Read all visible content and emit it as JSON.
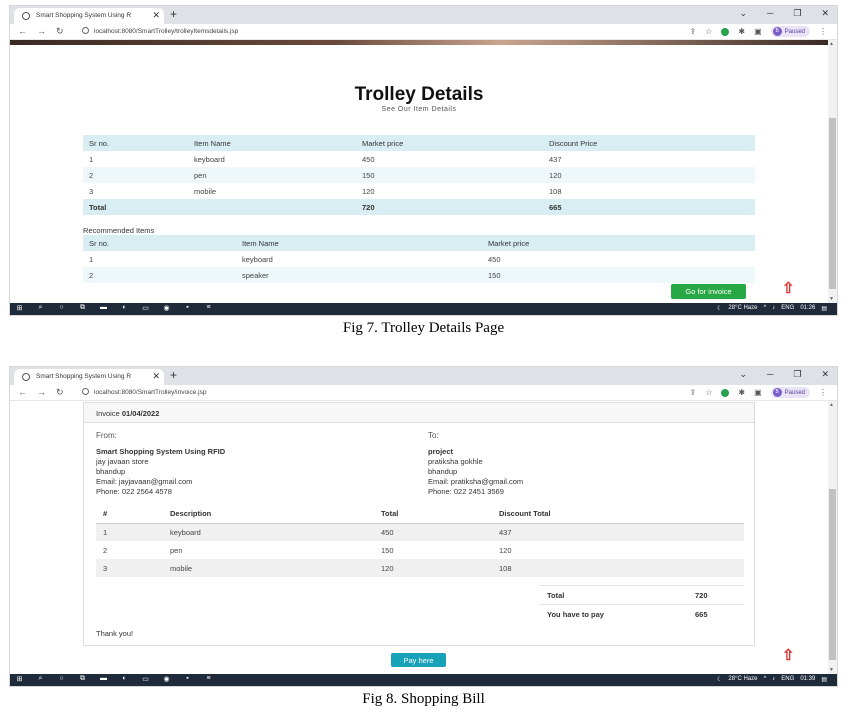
{
  "browser": {
    "tab_title_1": "Smart Shopping System Using R",
    "tab_title_2": "Smart Shopping System Using R",
    "url_1": "localhost:8080/SmartTrolley/trolleyItemsdetails.jsp",
    "url_2": "localhost:8080/SmartTrolley/invoice.jsp",
    "profile_status": "Paused",
    "profile_initial": "B"
  },
  "taskbar": {
    "weather": "28°C Haze",
    "lang": "ENG",
    "time_1": "01:26",
    "time_2": "01:39"
  },
  "trolley": {
    "title": "Trolley Details",
    "subtitle": "See Our Item Details",
    "headers": [
      "Sr no.",
      "Item Name",
      "Market price",
      "Discount Price"
    ],
    "rows": [
      [
        "1",
        "keyboard",
        "450",
        "437"
      ],
      [
        "2",
        "pen",
        "150",
        "120"
      ],
      [
        "3",
        "mobile",
        "120",
        "108"
      ]
    ],
    "total_label": "Total",
    "total_market": "720",
    "total_discount": "665",
    "recommended_label": "Recommended Items",
    "rec_headers": [
      "Sr no.",
      "Item Name",
      "Market price"
    ],
    "rec_rows": [
      [
        "1",
        "keyboard",
        "450"
      ],
      [
        "2",
        "speaker",
        "150"
      ]
    ],
    "invoice_button": "Go for invoice"
  },
  "invoice": {
    "label": "Invoice",
    "date": "01/04/2022",
    "from_label": "From:",
    "from_name": "Smart Shopping System Using RFID",
    "from_lines": [
      "jay javaan store",
      "bhandup",
      "Email: jayjavaan@gmail.com",
      "Phone: 022 2564 4578"
    ],
    "to_label": "To:",
    "to_name": "project",
    "to_lines": [
      "pratiksha gokhle",
      "bhandup",
      "Email: pratiksha@gmail.com",
      "Phone: 022 2451 3569"
    ],
    "headers": [
      "#",
      "Description",
      "Total",
      "Discount Total"
    ],
    "rows": [
      [
        "1",
        "keyboard",
        "450",
        "437"
      ],
      [
        "2",
        "pen",
        "150",
        "120"
      ],
      [
        "3",
        "mobile",
        "120",
        "108"
      ]
    ],
    "total_label": "Total",
    "total_value": "720",
    "pay_label": "You have to pay",
    "pay_value": "665",
    "thanks": "Thank you!",
    "pay_button": "Pay here"
  },
  "captions": {
    "fig7": "Fig 7. Trolley Details Page",
    "fig8": "Fig 8. Shopping Bill"
  }
}
